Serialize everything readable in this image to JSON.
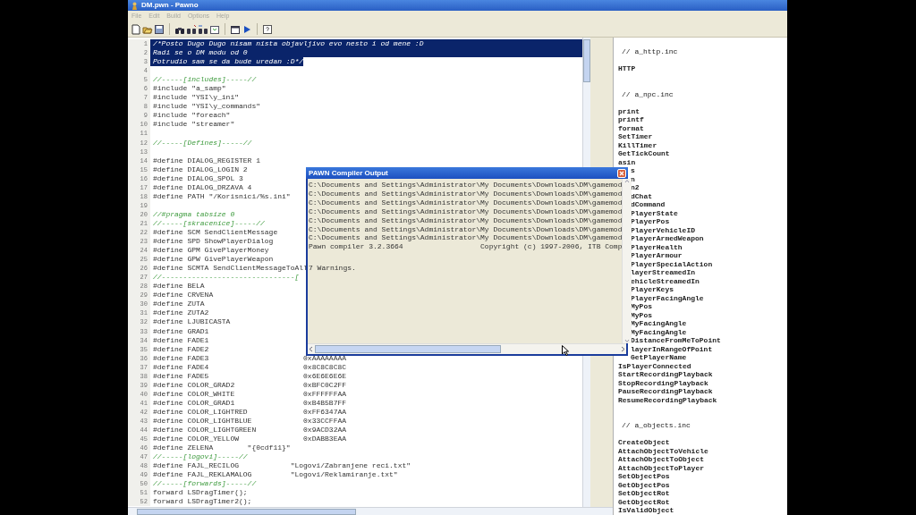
{
  "window": {
    "title": "DM.pwn - Pawno"
  },
  "menu": [
    "File",
    "Edit",
    "Build",
    "Options",
    "Help"
  ],
  "editor": {
    "lines": [
      {
        "n": "1",
        "text": "/*Posto Dugo Dugo nisam nista objavljivo evo nesto i od mene :D",
        "kind": "comment",
        "selected": true
      },
      {
        "n": "2",
        "text": "Radi se o DM modu od 0",
        "kind": "comment",
        "selected": true
      },
      {
        "n": "3",
        "text": "Potrudio sam se da bude uredan :D*/",
        "kind": "comment",
        "selected": true
      },
      {
        "n": "4",
        "selected": false
      },
      {
        "n": "5",
        "text": "//-----[includes]-----//",
        "kind": "comment",
        "selected": false
      },
      {
        "n": "6",
        "text": "#include \"a_samp\"",
        "kind": "code",
        "selected": false
      },
      {
        "n": "7",
        "text": "#include \"YSI\\y_ini\"",
        "kind": "code",
        "selected": false
      },
      {
        "n": "8",
        "text": "#include \"YSI\\y_commands\"",
        "kind": "code",
        "selected": false
      },
      {
        "n": "9",
        "text": "#include \"foreach\"",
        "kind": "code",
        "selected": false
      },
      {
        "n": "10",
        "text": "#include \"streamer\"",
        "kind": "code",
        "selected": false
      },
      {
        "n": "11",
        "selected": false
      },
      {
        "n": "12",
        "text": "//-----[Defines]-----//",
        "kind": "comment",
        "selected": false
      },
      {
        "n": "13",
        "selected": false
      },
      {
        "n": "14",
        "text": "#define DIALOG_REGISTER 1",
        "kind": "code",
        "selected": false
      },
      {
        "n": "15",
        "text": "#define DIALOG_LOGIN 2",
        "kind": "code",
        "selected": false
      },
      {
        "n": "16",
        "text": "#define DIALOG_SPOL 3",
        "kind": "code",
        "selected": false
      },
      {
        "n": "17",
        "text": "#define DIALOG_DRZAVA 4",
        "kind": "code",
        "selected": false
      },
      {
        "n": "18",
        "text": "#define PATH \"/Korisnici/%s.ini\"",
        "kind": "code",
        "selected": false
      },
      {
        "n": "19",
        "selected": false
      },
      {
        "n": "20",
        "text": "//#pragma tabsize 0",
        "kind": "comment",
        "selected": false
      },
      {
        "n": "21",
        "text": "//-----[skracenice]-----//",
        "kind": "comment",
        "selected": false
      },
      {
        "n": "22",
        "text": "#define SCM SendClientMessage",
        "kind": "code",
        "selected": false
      },
      {
        "n": "23",
        "text": "#define SPD ShowPlayerDialog",
        "kind": "code",
        "selected": false
      },
      {
        "n": "24",
        "text": "#define GPM GivePlayerMoney",
        "kind": "code",
        "selected": false
      },
      {
        "n": "25",
        "text": "#define GPW GivePlayerWeapon",
        "kind": "code",
        "selected": false
      },
      {
        "n": "26",
        "text": "#define SCMTA SendClientMessageToAll",
        "kind": "code",
        "selected": false
      },
      {
        "n": "27",
        "text": "//-------------------------------[",
        "kind": "comment",
        "selected": false
      },
      {
        "n": "28",
        "text": "#define BELA",
        "kind": "code",
        "selected": false
      },
      {
        "n": "29",
        "text": "#define CRVENA",
        "kind": "code",
        "selected": false
      },
      {
        "n": "30",
        "text": "#define ZUTA",
        "kind": "code",
        "selected": false
      },
      {
        "n": "31",
        "text": "#define ZUTA2",
        "kind": "code",
        "selected": false
      },
      {
        "n": "32",
        "text": "#define LJUBICASTA",
        "kind": "code",
        "selected": false
      },
      {
        "n": "33",
        "text": "#define GRAD1",
        "kind": "code",
        "selected": false
      },
      {
        "n": "34",
        "text": "#define FADE1",
        "kind": "code",
        "selected": false
      },
      {
        "n": "35",
        "text": "#define FADE2",
        "kind": "code",
        "selected": false
      },
      {
        "n": "36",
        "text": "#define FADE3                      0xAAAAAAAA",
        "kind": "code",
        "selected": false
      },
      {
        "n": "37",
        "text": "#define FADE4                      0x8C8C8C8C",
        "kind": "code",
        "selected": false
      },
      {
        "n": "38",
        "text": "#define FADE5                      0x6E6E6E6E",
        "kind": "code",
        "selected": false
      },
      {
        "n": "39",
        "text": "#define COLOR_GRAD2                0xBFC0C2FF",
        "kind": "code",
        "selected": false
      },
      {
        "n": "40",
        "text": "#define COLOR_WHITE                0xFFFFFFAA",
        "kind": "code",
        "selected": false
      },
      {
        "n": "41",
        "text": "#define COLOR_GRAD1                0xB4B5B7FF",
        "kind": "code",
        "selected": false
      },
      {
        "n": "42",
        "text": "#define COLOR_LIGHTRED             0xFF6347AA",
        "kind": "code",
        "selected": false
      },
      {
        "n": "43",
        "text": "#define COLOR_LIGHTBLUE            0x33CCFFAA",
        "kind": "code",
        "selected": false
      },
      {
        "n": "44",
        "text": "#define COLOR_LIGHTGREEN           0x9ACD32AA",
        "kind": "code",
        "selected": false
      },
      {
        "n": "45",
        "text": "#define COLOR_YELLOW               0xDABB3EAA",
        "kind": "code",
        "selected": false
      },
      {
        "n": "46",
        "text": "#define ZELENA        \"{0cdf11}\"",
        "kind": "code",
        "selected": false
      },
      {
        "n": "47",
        "text": "//-----[logovi]-----//",
        "kind": "comment",
        "selected": false
      },
      {
        "n": "48",
        "text": "#define FAJL_RECILOG            \"Logovi/Zabranjene reci.txt\"",
        "kind": "code",
        "selected": false
      },
      {
        "n": "49",
        "text": "#define FAJL_REKLAMALOG         \"Logovi/Reklamiranje.txt\"",
        "kind": "code",
        "selected": false
      },
      {
        "n": "50",
        "text": "//-----[forwards]-----//",
        "kind": "comment",
        "selected": false
      },
      {
        "n": "51",
        "text": "forward LSDragTimer();",
        "kind": "code",
        "selected": false
      },
      {
        "n": "52",
        "text": "forward LSDragTimer2();",
        "kind": "code",
        "selected": false
      }
    ]
  },
  "function_list": {
    "groups": [
      {
        "header": "// a_http.inc",
        "items": [
          "HTTP"
        ]
      },
      {
        "header": "// a_npc.inc",
        "items": [
          "print",
          "printf",
          "format",
          "SetTimer",
          "KillTimer",
          "GetTickCount",
          "asin",
          "s",
          "n",
          "n2",
          "dChat",
          "dCommand",
          "PlayerState",
          "PlayerPos",
          "PlayerVehicleID",
          "PlayerArmedWeapon",
          "PlayerHealth",
          "PlayerArmour",
          "PlayerSpecialAction",
          "layerStreamedIn",
          "ehicleStreamedIn",
          "PlayerKeys",
          "PlayerFacingAngle",
          "MyPos",
          "MyPos",
          "MyFacingAngle",
          "MyFacingAngle",
          "DistanceFromMeToPoint",
          "layerInRangeOfPoint",
          "GetPlayerName",
          "IsPlayerConnected",
          "StartRecordingPlayback",
          "StopRecordingPlayback",
          "PauseRecordingPlayback",
          "ResumeRecordingPlayback"
        ]
      },
      {
        "header": "// a_objects.inc",
        "items": [
          "CreateObject",
          "AttachObjectToVehicle",
          "AttachObjectToObject",
          "AttachObjectToPlayer",
          "SetObjectPos",
          "GetObjectPos",
          "SetObjectRot",
          "GetObjectRot",
          "IsValidObject"
        ]
      }
    ]
  },
  "output_dialog": {
    "title": "PAWN Compiler Output",
    "lines": [
      "C:\\Documents and Settings\\Administrator\\My Documents\\Downloads\\DM\\gamemod",
      "C:\\Documents and Settings\\Administrator\\My Documents\\Downloads\\DM\\gamemod",
      "C:\\Documents and Settings\\Administrator\\My Documents\\Downloads\\DM\\gamemod",
      "C:\\Documents and Settings\\Administrator\\My Documents\\Downloads\\DM\\gamemod",
      "C:\\Documents and Settings\\Administrator\\My Documents\\Downloads\\DM\\gamemod",
      "C:\\Documents and Settings\\Administrator\\My Documents\\Downloads\\DM\\gamemod",
      "C:\\Documents and Settings\\Administrator\\My Documents\\Downloads\\DM\\gamemod",
      "Pawn compiler 3.2.3664                  Copyright (c) 1997-2006, ITB Comp"
    ],
    "summary": "7 Warnings."
  }
}
